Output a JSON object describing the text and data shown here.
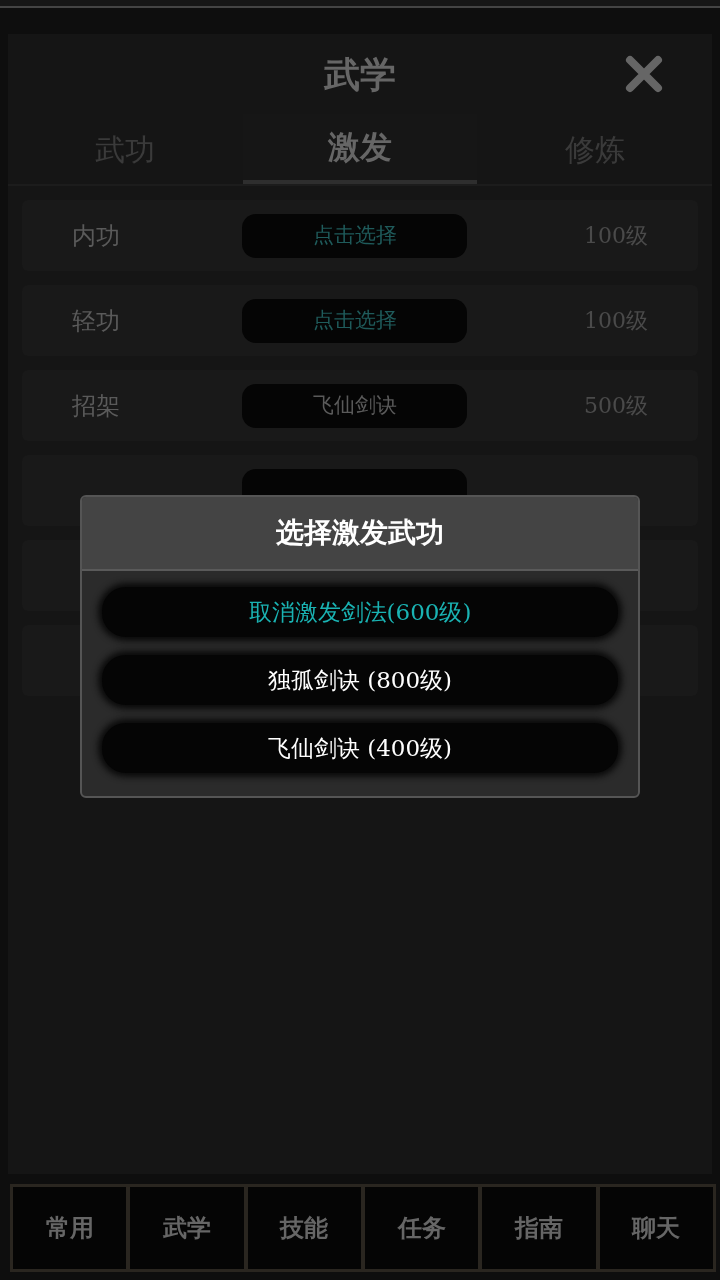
{
  "title": "武学",
  "tabs": [
    {
      "label": "武功",
      "selected": false
    },
    {
      "label": "激发",
      "selected": true
    },
    {
      "label": "修炼",
      "selected": false
    }
  ],
  "rows": [
    {
      "name": "内功",
      "choice": "点击选择",
      "assigned": false,
      "level": "100级"
    },
    {
      "name": "轻功",
      "choice": "点击选择",
      "assigned": false,
      "level": "100级"
    },
    {
      "name": "招架",
      "choice": "飞仙剑诀",
      "assigned": true,
      "level": "500级"
    }
  ],
  "dialog": {
    "title": "选择激发武功",
    "options": [
      {
        "label": "取消激发剑法(600级)",
        "kind": "cancel"
      },
      {
        "label": "独孤剑诀 (800级)",
        "kind": "skill"
      },
      {
        "label": "飞仙剑诀 (400级)",
        "kind": "skill"
      }
    ]
  },
  "bottom_nav": [
    "常用",
    "武学",
    "技能",
    "任务",
    "指南",
    "聊天"
  ]
}
